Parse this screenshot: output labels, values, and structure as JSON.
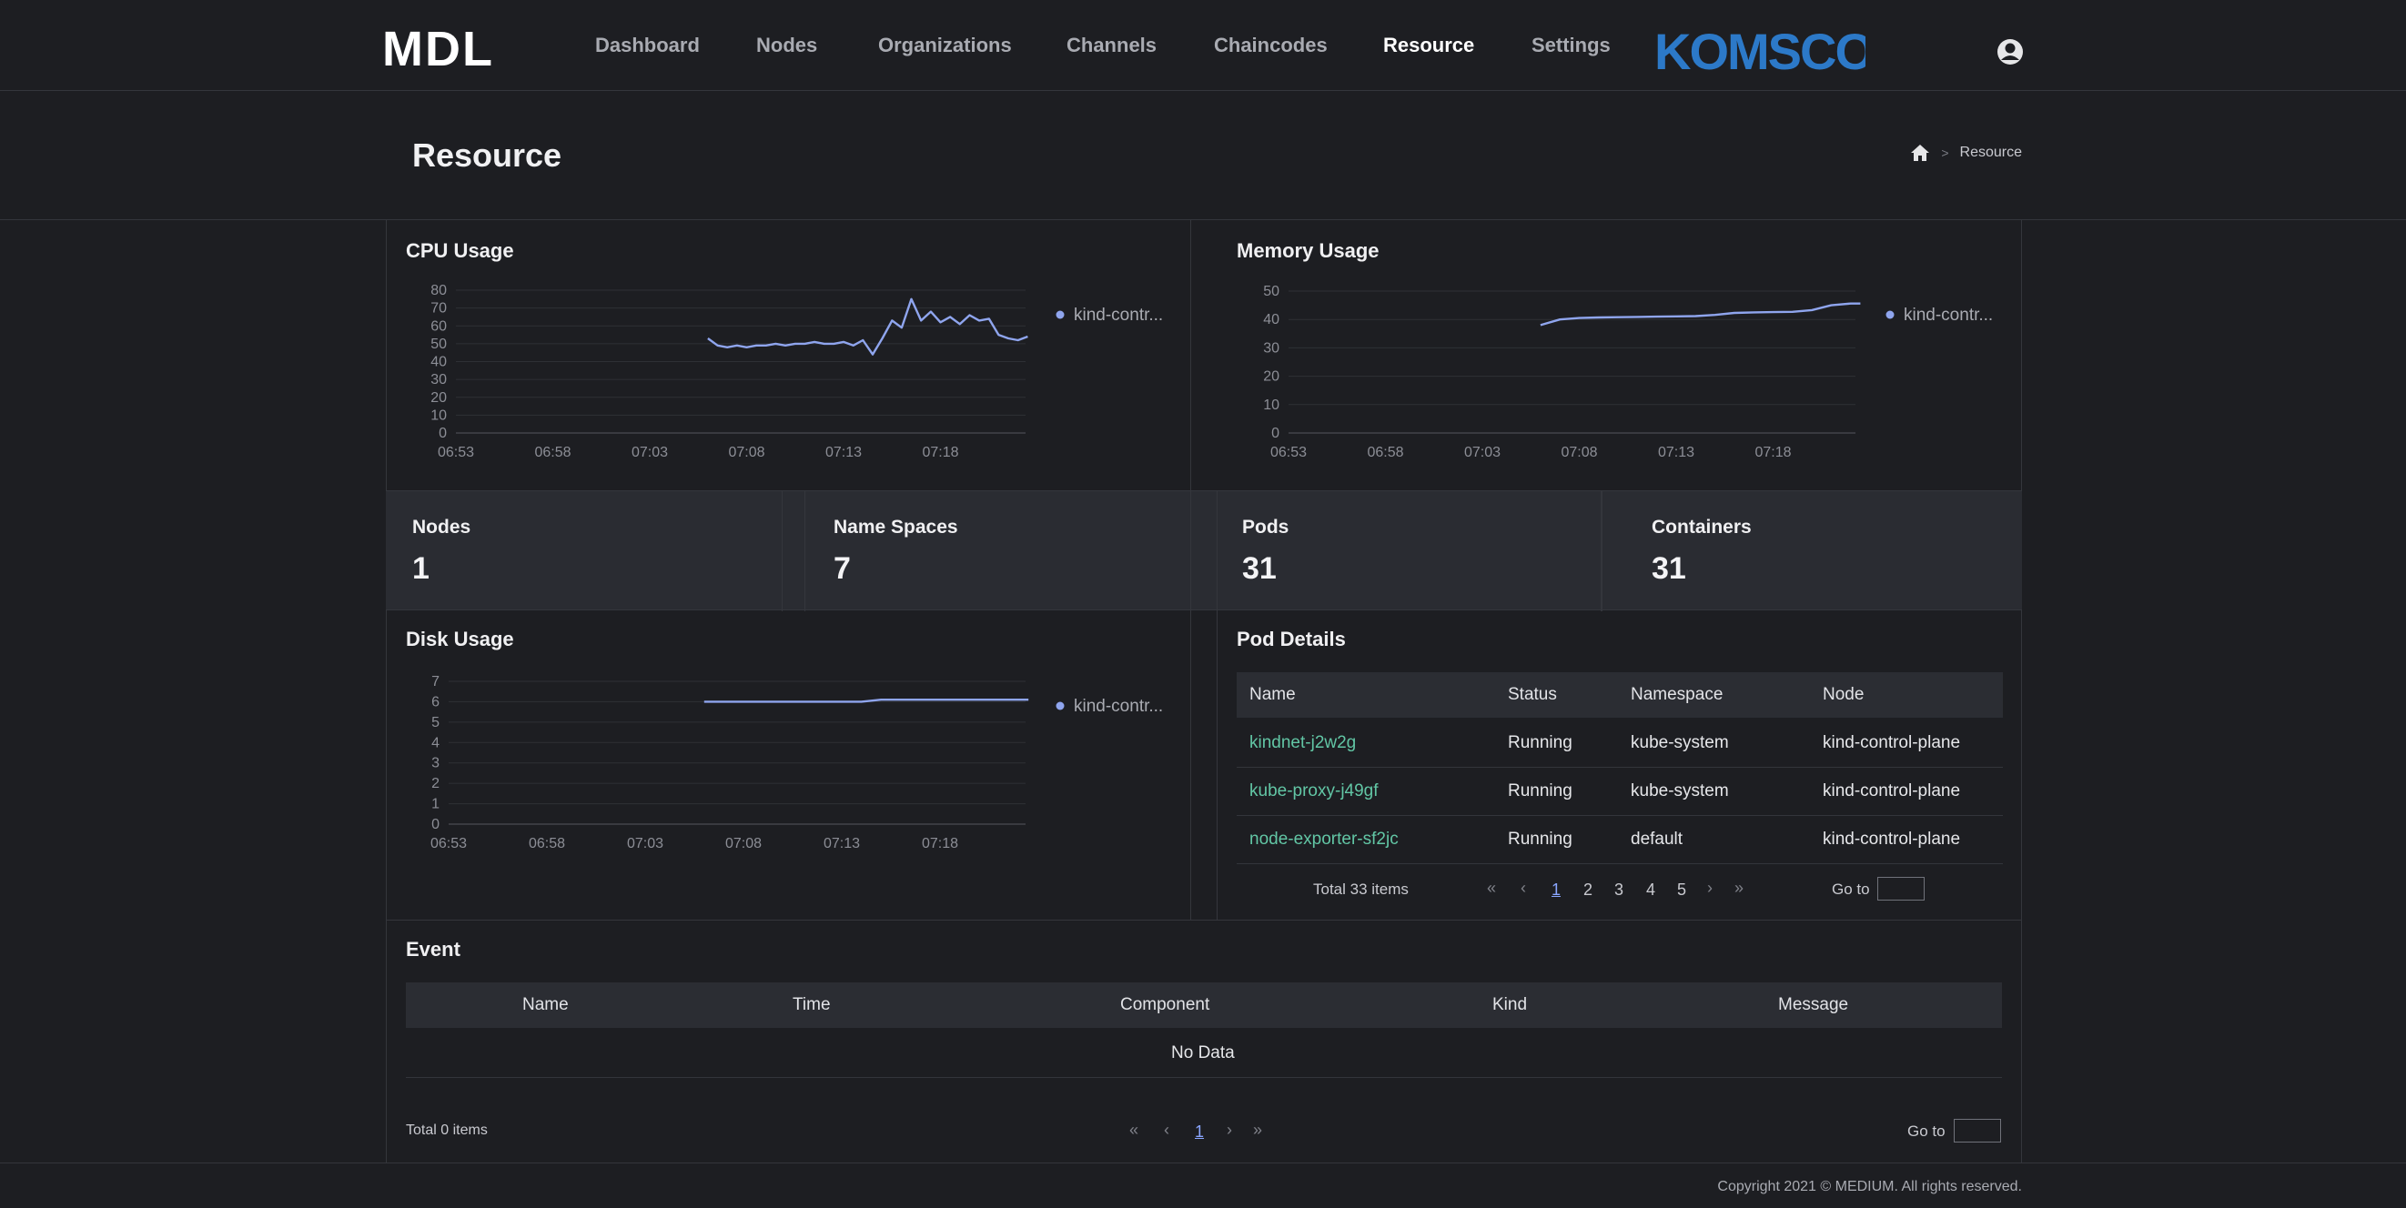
{
  "header": {
    "logo_text": "MDL",
    "brand_logo_text": "KOMSCO",
    "nav": [
      {
        "label": "Dashboard",
        "active": false
      },
      {
        "label": "Nodes",
        "active": false
      },
      {
        "label": "Organizations",
        "active": false
      },
      {
        "label": "Channels",
        "active": false
      },
      {
        "label": "Chaincodes",
        "active": false
      },
      {
        "label": "Resource",
        "active": true
      },
      {
        "label": "Settings",
        "active": false
      }
    ],
    "user_icon": "user-icon"
  },
  "page": {
    "title": "Resource",
    "breadcrumb": {
      "home_icon": "home-icon",
      "separator": ">",
      "current": "Resource"
    }
  },
  "cpu": {
    "title": "CPU Usage",
    "legend": "kind-contr..."
  },
  "memory": {
    "title": "Memory Usage",
    "legend": "kind-contr..."
  },
  "disk": {
    "title": "Disk Usage",
    "legend": "kind-contr..."
  },
  "stats": [
    {
      "label": "Nodes",
      "value": "1"
    },
    {
      "label": "Name Spaces",
      "value": "7"
    },
    {
      "label": "Pods",
      "value": "31"
    },
    {
      "label": "Containers",
      "value": "31"
    }
  ],
  "pod_details": {
    "title": "Pod Details",
    "columns": [
      "Name",
      "Status",
      "Namespace",
      "Node"
    ],
    "rows": [
      [
        "kindnet-j2w2g",
        "Running",
        "kube-system",
        "kind-control-plane"
      ],
      [
        "kube-proxy-j49gf",
        "Running",
        "kube-system",
        "kind-control-plane"
      ],
      [
        "node-exporter-sf2jc",
        "Running",
        "default",
        "kind-control-plane"
      ]
    ],
    "total": "Total 33 items",
    "pages": [
      "1",
      "2",
      "3",
      "4",
      "5"
    ],
    "current_page": "1",
    "goto_label": "Go to"
  },
  "event": {
    "title": "Event",
    "columns": [
      "Name",
      "Time",
      "Component",
      "Kind",
      "Message"
    ],
    "empty": "No Data",
    "total": "Total 0 items",
    "pages": [
      "1"
    ],
    "goto_label": "Go to"
  },
  "footer": {
    "copyright": "Copyright 2021 © MEDIUM. All rights reserved."
  },
  "colors": {
    "line": "#8fa5ee",
    "accent_link": "#62c6a5",
    "background": "#1d1e22"
  },
  "chart_data": [
    {
      "type": "line",
      "title": "CPU Usage",
      "x_ticks": [
        "06:53",
        "06:58",
        "07:03",
        "07:08",
        "07:13",
        "07:18"
      ],
      "y_ticks": [
        0,
        10,
        20,
        30,
        40,
        50,
        60,
        70,
        80
      ],
      "ylim": [
        0,
        80
      ],
      "grid": true,
      "legend_position": "right",
      "series": [
        {
          "name": "kind-contr...",
          "x": [
            "07:06",
            "07:06:30",
            "07:07",
            "07:07:30",
            "07:08",
            "07:08:30",
            "07:09",
            "07:09:30",
            "07:10",
            "07:10:30",
            "07:11",
            "07:11:30",
            "07:12",
            "07:12:30",
            "07:13",
            "07:13:30",
            "07:14",
            "07:14:30",
            "07:15",
            "07:15:30",
            "07:16",
            "07:16:30",
            "07:17",
            "07:17:30",
            "07:18",
            "07:18:30",
            "07:19",
            "07:19:30",
            "07:20",
            "07:20:30",
            "07:21",
            "07:21:30",
            "07:22",
            "07:22:30"
          ],
          "values": [
            53,
            49,
            48,
            49,
            48,
            49,
            49,
            50,
            49,
            50,
            50,
            51,
            50,
            50,
            51,
            49,
            52,
            44,
            53,
            63,
            59,
            75,
            63,
            68,
            62,
            65,
            61,
            66,
            63,
            64,
            55,
            53,
            52,
            54
          ]
        }
      ]
    },
    {
      "type": "line",
      "title": "Memory Usage",
      "x_ticks": [
        "06:53",
        "06:58",
        "07:03",
        "07:08",
        "07:13",
        "07:18"
      ],
      "y_ticks": [
        0,
        10,
        20,
        30,
        40,
        50
      ],
      "ylim": [
        0,
        50
      ],
      "grid": true,
      "legend_position": "right",
      "series": [
        {
          "name": "kind-contr...",
          "x": [
            "07:06",
            "07:07",
            "07:08",
            "07:09",
            "07:10",
            "07:11",
            "07:12",
            "07:13",
            "07:14",
            "07:15",
            "07:16",
            "07:17",
            "07:18",
            "07:19",
            "07:20",
            "07:21",
            "07:22",
            "07:22:30"
          ],
          "values": [
            38,
            40,
            40.5,
            40.7,
            40.8,
            40.9,
            41,
            41.1,
            41.2,
            41.6,
            42.3,
            42.5,
            42.6,
            42.7,
            43.3,
            45,
            45.6,
            45.6
          ]
        }
      ]
    },
    {
      "type": "line",
      "title": "Disk Usage",
      "x_ticks": [
        "06:53",
        "06:58",
        "07:03",
        "07:08",
        "07:13",
        "07:18"
      ],
      "y_ticks": [
        0,
        1,
        2,
        3,
        4,
        5,
        6,
        7
      ],
      "ylim": [
        0,
        7
      ],
      "grid": true,
      "legend_position": "right",
      "series": [
        {
          "name": "kind-contr...",
          "x": [
            "07:06",
            "07:08",
            "07:10",
            "07:12",
            "07:14",
            "07:15",
            "07:16",
            "07:18",
            "07:20",
            "07:22",
            "07:22:30"
          ],
          "values": [
            6.0,
            6.0,
            6.0,
            6.0,
            6.0,
            6.1,
            6.1,
            6.1,
            6.1,
            6.1,
            6.1
          ]
        }
      ]
    }
  ]
}
